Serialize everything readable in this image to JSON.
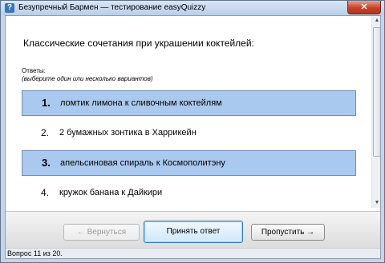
{
  "window": {
    "title": "Безупречный Бармен — тестирование easyQuizzy",
    "app_icon": "?",
    "close_label": "✕"
  },
  "question": {
    "text": "Классические сочетания при украшении коктейлей:"
  },
  "answers": {
    "label": "Ответы:",
    "hint": "(выберите один или несколько вариантов)",
    "items": [
      {
        "num": "1.",
        "text": "ломтик лимона к сливочным коктейлям",
        "selected": true
      },
      {
        "num": "2.",
        "text": "2 бумажных зонтика в Харрикейн",
        "selected": false
      },
      {
        "num": "3.",
        "text": "апельсиновая спираль к Космополитэну",
        "selected": true
      },
      {
        "num": "4.",
        "text": "кружок банана к Дайкири",
        "selected": false
      }
    ]
  },
  "buttons": {
    "back": "← Вернуться",
    "accept": "Принять ответ",
    "skip": "Пропустить →"
  },
  "status": {
    "text": "Вопрос 11 из 20."
  },
  "colors": {
    "selected_bg": "#a9c9ef",
    "selected_border": "#6a8fbc"
  }
}
